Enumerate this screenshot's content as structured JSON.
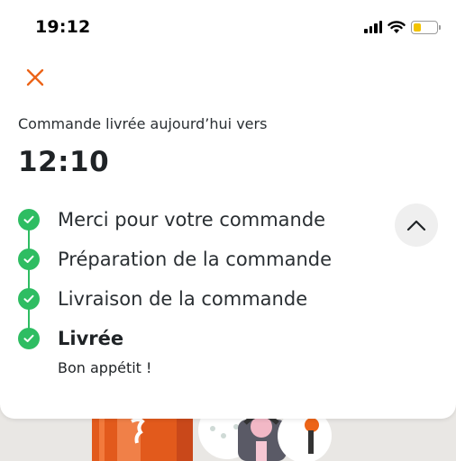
{
  "status_bar": {
    "time": "19:12",
    "icons": [
      "signal-icon",
      "wifi-icon",
      "battery-icon"
    ]
  },
  "header": {
    "close_icon": "close-icon"
  },
  "order": {
    "eta_label": "Commande livrée aujourd’hui vers",
    "eta_time": "12:10"
  },
  "timeline": {
    "steps": [
      {
        "label": "Merci pour votre commande",
        "done": true,
        "active": false
      },
      {
        "label": "Préparation de la commande",
        "done": true,
        "active": false
      },
      {
        "label": "Livraison de la commande",
        "done": true,
        "active": false
      },
      {
        "label": "Livrée",
        "done": true,
        "active": true
      }
    ],
    "final_message": "Bon appétit !"
  },
  "controls": {
    "collapse_icon": "chevron-up-icon"
  },
  "colors": {
    "accent": "#ec6418",
    "success": "#2ebd62",
    "text": "#2a2f33",
    "background": "#ffffff",
    "page_bg": "#e9e7e4",
    "battery": "#f2c300"
  }
}
